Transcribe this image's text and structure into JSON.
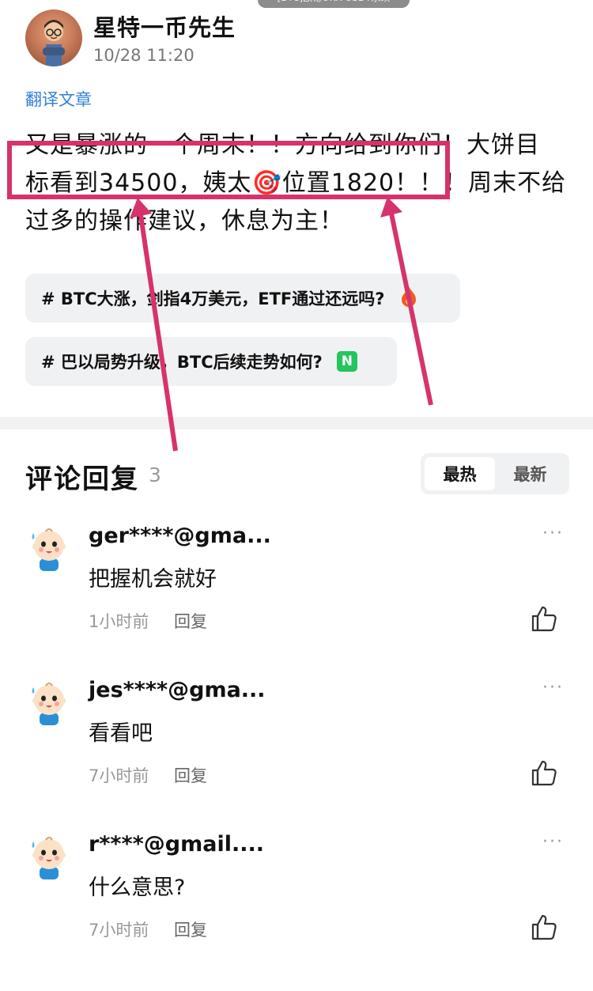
{
  "top_pill": "[BTC]欧易OKX USDT永续",
  "author": {
    "name": "星特一币先生",
    "time": "10/28 11:20",
    "avatar_icon": "cartoon-person-avatar"
  },
  "translate_label": "翻译文章",
  "post": {
    "line1": "又是暴涨的一个周末！！方向给到你们！大饼目",
    "line2_a": "标看到34500，姨太",
    "line2_emoji": "🎯",
    "line2_b": "位置1820！！！周末不给",
    "line3": "过多的操作建议，休息为主！"
  },
  "tags": [
    {
      "label": "# BTC大涨，剑指4万美元，ETF通过还远吗?",
      "icon": "fire-icon"
    },
    {
      "label": "# 巴以局势升级，BTC后续走势如何?",
      "icon": "new-badge-icon",
      "icon_text": "N"
    }
  ],
  "comments_section": {
    "title": "评论回复",
    "count": "3",
    "sort": {
      "hot": "最热",
      "newest": "最新",
      "active": "hot"
    }
  },
  "comments": [
    {
      "user": "ger****@gma...",
      "text": "把握机会就好",
      "time": "1小时前",
      "reply": "回复",
      "more": "···"
    },
    {
      "user": "jes****@gma...",
      "text": "看看吧",
      "time": "7小时前",
      "reply": "回复",
      "more": "···"
    },
    {
      "user": "r****@gmail....",
      "text": "什么意思?",
      "time": "7小时前",
      "reply": "回复",
      "more": "···"
    }
  ],
  "colors": {
    "annotation": "#d6336c",
    "link": "#2f7fd8",
    "new_badge": "#22c55e",
    "fire": "#f05a24"
  }
}
